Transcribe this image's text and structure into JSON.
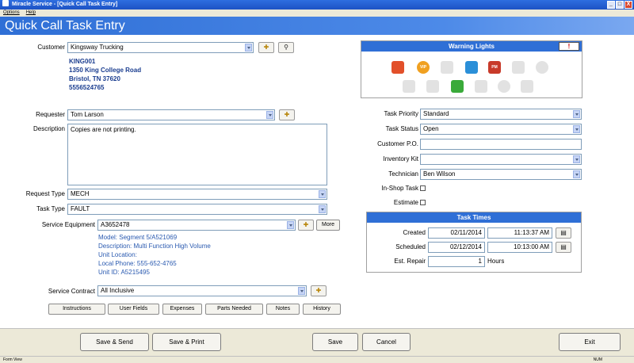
{
  "window": {
    "title": "Miracle Service - [Quick Call Task Entry]",
    "buttons": [
      "_",
      "□",
      "X"
    ]
  },
  "menu": {
    "items": [
      "Options",
      "Help"
    ]
  },
  "page_title": "Quick Call Task Entry",
  "customer": {
    "label": "Customer",
    "value": "Kingsway Trucking",
    "code": "KING001",
    "address1": "1350 King College Road",
    "address2": "Bristol, TN 37620",
    "phone": "5556524765"
  },
  "requester": {
    "label": "Requester",
    "value": "Tom Larson"
  },
  "description": {
    "label": "Description",
    "value": "Copies are not printing."
  },
  "request_type": {
    "label": "Request Type",
    "value": "MECH"
  },
  "task_type": {
    "label": "Task Type",
    "value": "FAULT"
  },
  "service_equipment": {
    "label": "Service Equipment",
    "value": "A3652478",
    "more_label": "More",
    "details": [
      "Model: Segment 5/A521069",
      "Description: Multi Function High Volume",
      "Unit Location:",
      "Local Phone: 555-652-4765",
      "Unit ID: A5215495"
    ]
  },
  "service_contract": {
    "label": "Service Contract",
    "value": "All Inclusive"
  },
  "tab_buttons": [
    "Instructions",
    "User Fields",
    "Expenses",
    "Parts Needed",
    "Notes",
    "History"
  ],
  "warning_lights": {
    "title": "Warning Lights",
    "alert_label": "!",
    "icons": [
      {
        "name": "stop-sign-icon",
        "color": "#e2502a",
        "text": ""
      },
      {
        "name": "vip-icon",
        "color": "#f0a020",
        "text": "VIP"
      },
      {
        "name": "document-check-icon",
        "color": "#d8d8d8",
        "text": ""
      },
      {
        "name": "chat-bubbles-icon",
        "color": "#2a8fd8",
        "text": ""
      },
      {
        "name": "pm-calendar-icon",
        "color": "#c83a2a",
        "text": "PM"
      },
      {
        "name": "phone-icon",
        "color": "#d8d8d8",
        "text": ""
      },
      {
        "name": "info-circle-icon",
        "color": "#d8d8d8",
        "text": ""
      },
      {
        "name": "speech-bubble-icon",
        "color": "#d8d8d8",
        "text": ""
      },
      {
        "name": "truck-icon",
        "color": "#d8d8d8",
        "text": ""
      },
      {
        "name": "shield-check-icon",
        "color": "#3aaa3a",
        "text": ""
      },
      {
        "name": "warning-triangle-icon",
        "color": "#d8d8d8",
        "text": ""
      },
      {
        "name": "pie-chart-icon",
        "color": "#d8d8d8",
        "text": ""
      },
      {
        "name": "copy-pages-icon",
        "color": "#d8d8d8",
        "text": ""
      }
    ]
  },
  "right_fields": {
    "task_priority": {
      "label": "Task Priority",
      "value": "Standard"
    },
    "task_status": {
      "label": "Task Status",
      "value": "Open"
    },
    "customer_po": {
      "label": "Customer P.O.",
      "value": ""
    },
    "inventory_kit": {
      "label": "Inventory Kit",
      "value": ""
    },
    "technician": {
      "label": "Technician",
      "value": "Ben Wilson"
    },
    "in_shop_task": {
      "label": "In-Shop Task"
    },
    "estimate": {
      "label": "Estimate"
    }
  },
  "task_times": {
    "title": "Task Times",
    "created": {
      "label": "Created",
      "date": "02/11/2014",
      "time": "11:13:37 AM"
    },
    "scheduled": {
      "label": "Scheduled",
      "date": "02/12/2014",
      "time": "10:13:00 AM"
    },
    "est_repair": {
      "label": "Est. Repair",
      "value": "1",
      "unit": "Hours"
    }
  },
  "footer_buttons": {
    "save_send": "Save & Send",
    "save_print": "Save & Print",
    "save": "Save",
    "cancel": "Cancel",
    "exit": "Exit"
  },
  "status": {
    "left": "Form View",
    "num": "NUM"
  }
}
